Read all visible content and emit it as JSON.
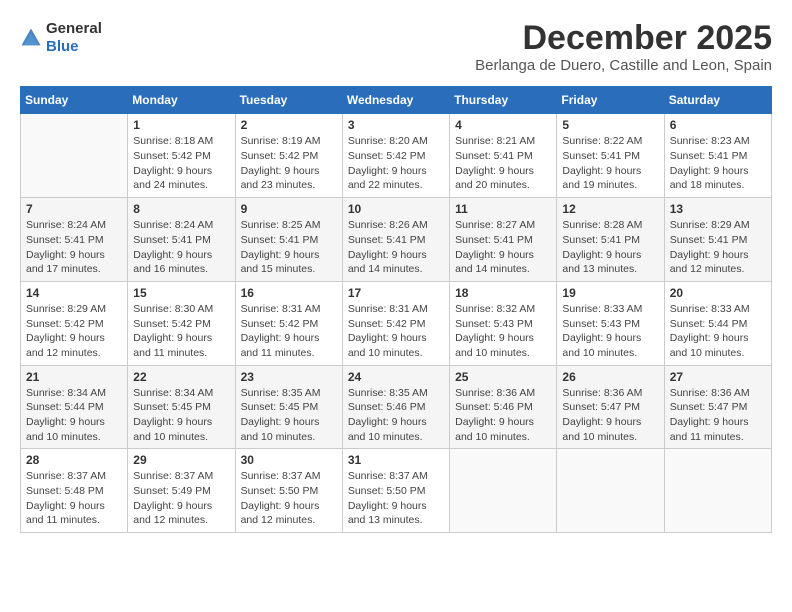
{
  "header": {
    "logo_general": "General",
    "logo_blue": "Blue",
    "title": "December 2025",
    "subtitle": "Berlanga de Duero, Castille and Leon, Spain"
  },
  "calendar": {
    "days_of_week": [
      "Sunday",
      "Monday",
      "Tuesday",
      "Wednesday",
      "Thursday",
      "Friday",
      "Saturday"
    ],
    "weeks": [
      [
        {
          "day": "",
          "info": ""
        },
        {
          "day": "1",
          "info": "Sunrise: 8:18 AM\nSunset: 5:42 PM\nDaylight: 9 hours\nand 24 minutes."
        },
        {
          "day": "2",
          "info": "Sunrise: 8:19 AM\nSunset: 5:42 PM\nDaylight: 9 hours\nand 23 minutes."
        },
        {
          "day": "3",
          "info": "Sunrise: 8:20 AM\nSunset: 5:42 PM\nDaylight: 9 hours\nand 22 minutes."
        },
        {
          "day": "4",
          "info": "Sunrise: 8:21 AM\nSunset: 5:41 PM\nDaylight: 9 hours\nand 20 minutes."
        },
        {
          "day": "5",
          "info": "Sunrise: 8:22 AM\nSunset: 5:41 PM\nDaylight: 9 hours\nand 19 minutes."
        },
        {
          "day": "6",
          "info": "Sunrise: 8:23 AM\nSunset: 5:41 PM\nDaylight: 9 hours\nand 18 minutes."
        }
      ],
      [
        {
          "day": "7",
          "info": "Sunrise: 8:24 AM\nSunset: 5:41 PM\nDaylight: 9 hours\nand 17 minutes."
        },
        {
          "day": "8",
          "info": "Sunrise: 8:24 AM\nSunset: 5:41 PM\nDaylight: 9 hours\nand 16 minutes."
        },
        {
          "day": "9",
          "info": "Sunrise: 8:25 AM\nSunset: 5:41 PM\nDaylight: 9 hours\nand 15 minutes."
        },
        {
          "day": "10",
          "info": "Sunrise: 8:26 AM\nSunset: 5:41 PM\nDaylight: 9 hours\nand 14 minutes."
        },
        {
          "day": "11",
          "info": "Sunrise: 8:27 AM\nSunset: 5:41 PM\nDaylight: 9 hours\nand 14 minutes."
        },
        {
          "day": "12",
          "info": "Sunrise: 8:28 AM\nSunset: 5:41 PM\nDaylight: 9 hours\nand 13 minutes."
        },
        {
          "day": "13",
          "info": "Sunrise: 8:29 AM\nSunset: 5:41 PM\nDaylight: 9 hours\nand 12 minutes."
        }
      ],
      [
        {
          "day": "14",
          "info": "Sunrise: 8:29 AM\nSunset: 5:42 PM\nDaylight: 9 hours\nand 12 minutes."
        },
        {
          "day": "15",
          "info": "Sunrise: 8:30 AM\nSunset: 5:42 PM\nDaylight: 9 hours\nand 11 minutes."
        },
        {
          "day": "16",
          "info": "Sunrise: 8:31 AM\nSunset: 5:42 PM\nDaylight: 9 hours\nand 11 minutes."
        },
        {
          "day": "17",
          "info": "Sunrise: 8:31 AM\nSunset: 5:42 PM\nDaylight: 9 hours\nand 10 minutes."
        },
        {
          "day": "18",
          "info": "Sunrise: 8:32 AM\nSunset: 5:43 PM\nDaylight: 9 hours\nand 10 minutes."
        },
        {
          "day": "19",
          "info": "Sunrise: 8:33 AM\nSunset: 5:43 PM\nDaylight: 9 hours\nand 10 minutes."
        },
        {
          "day": "20",
          "info": "Sunrise: 8:33 AM\nSunset: 5:44 PM\nDaylight: 9 hours\nand 10 minutes."
        }
      ],
      [
        {
          "day": "21",
          "info": "Sunrise: 8:34 AM\nSunset: 5:44 PM\nDaylight: 9 hours\nand 10 minutes."
        },
        {
          "day": "22",
          "info": "Sunrise: 8:34 AM\nSunset: 5:45 PM\nDaylight: 9 hours\nand 10 minutes."
        },
        {
          "day": "23",
          "info": "Sunrise: 8:35 AM\nSunset: 5:45 PM\nDaylight: 9 hours\nand 10 minutes."
        },
        {
          "day": "24",
          "info": "Sunrise: 8:35 AM\nSunset: 5:46 PM\nDaylight: 9 hours\nand 10 minutes."
        },
        {
          "day": "25",
          "info": "Sunrise: 8:36 AM\nSunset: 5:46 PM\nDaylight: 9 hours\nand 10 minutes."
        },
        {
          "day": "26",
          "info": "Sunrise: 8:36 AM\nSunset: 5:47 PM\nDaylight: 9 hours\nand 10 minutes."
        },
        {
          "day": "27",
          "info": "Sunrise: 8:36 AM\nSunset: 5:47 PM\nDaylight: 9 hours\nand 11 minutes."
        }
      ],
      [
        {
          "day": "28",
          "info": "Sunrise: 8:37 AM\nSunset: 5:48 PM\nDaylight: 9 hours\nand 11 minutes."
        },
        {
          "day": "29",
          "info": "Sunrise: 8:37 AM\nSunset: 5:49 PM\nDaylight: 9 hours\nand 12 minutes."
        },
        {
          "day": "30",
          "info": "Sunrise: 8:37 AM\nSunset: 5:50 PM\nDaylight: 9 hours\nand 12 minutes."
        },
        {
          "day": "31",
          "info": "Sunrise: 8:37 AM\nSunset: 5:50 PM\nDaylight: 9 hours\nand 13 minutes."
        },
        {
          "day": "",
          "info": ""
        },
        {
          "day": "",
          "info": ""
        },
        {
          "day": "",
          "info": ""
        }
      ]
    ]
  }
}
